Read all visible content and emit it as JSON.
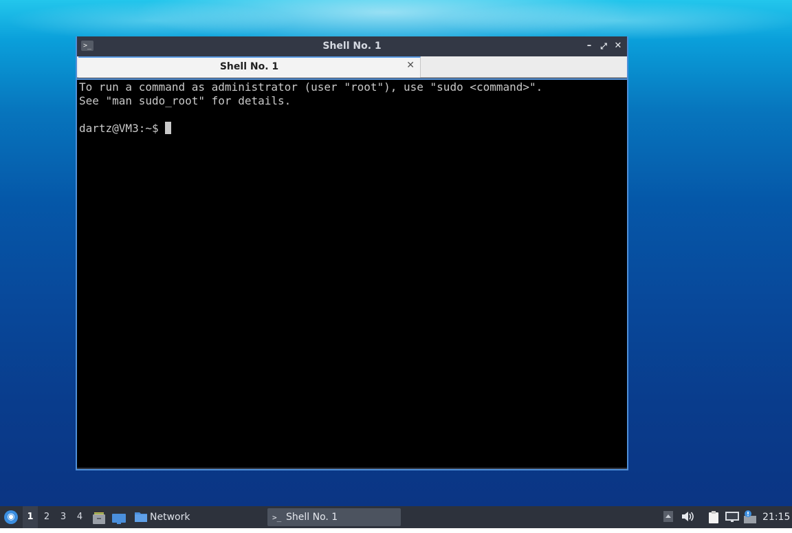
{
  "window": {
    "title": "Shell No. 1",
    "app_icon": ">_",
    "minimize_glyph": "–",
    "maximize_glyph": "⤢",
    "close_glyph": "✕",
    "tab": {
      "label": "Shell No. 1",
      "close_glyph": "✕"
    }
  },
  "terminal": {
    "lines": [
      "To run a command as administrator (user \"root\"), use \"sudo <command>\".",
      "See \"man sudo_root\" for details.",
      "",
      "dartz@VM3:~$ "
    ]
  },
  "taskbar": {
    "start_icon": "start-menu-icon",
    "workspaces": [
      "1",
      "2",
      "3",
      "4"
    ],
    "active_workspace": "1",
    "quicklaunch": [
      {
        "name": "file-manager-icon"
      },
      {
        "name": "show-desktop-icon"
      }
    ],
    "network_label": "Network",
    "task_label": "Shell No. 1",
    "task_icon": ">_",
    "clock": "21:15"
  },
  "colors": {
    "accent": "#5b9be4",
    "terminal_bg": "#000000",
    "terminal_fg": "#c9c9c9",
    "panel_bg": "#2d323c"
  }
}
